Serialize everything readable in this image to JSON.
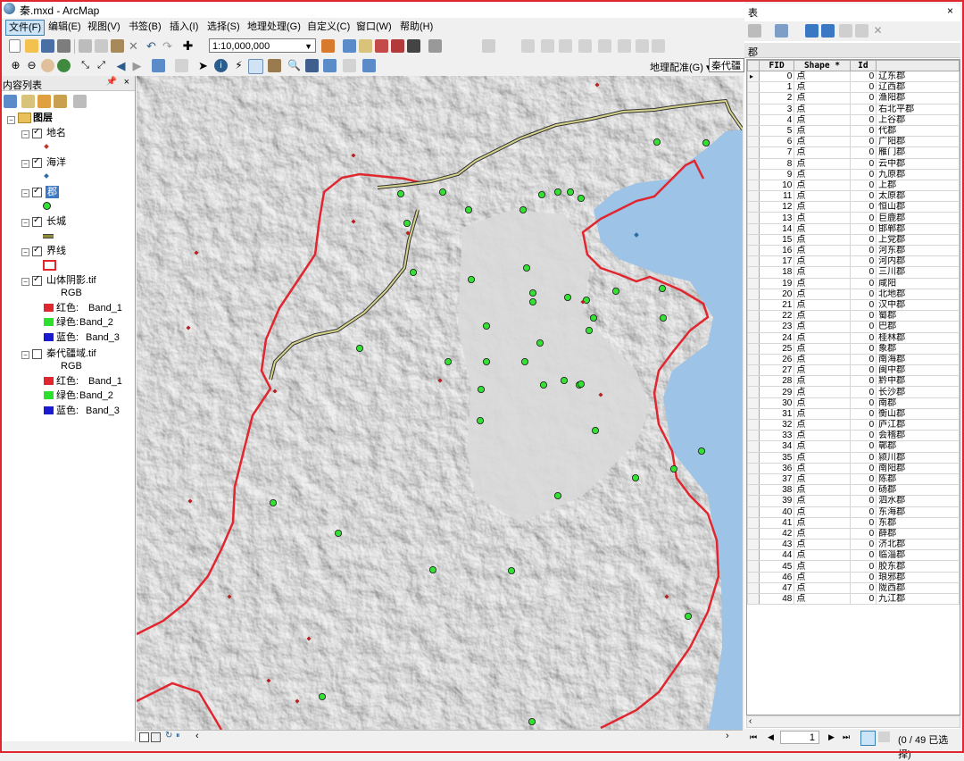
{
  "window": {
    "title": "秦.mxd - ArcMap"
  },
  "menubar": [
    "文件(F)",
    "编辑(E)",
    "视图(V)",
    "书签(B)",
    "插入(I)",
    "选择(S)",
    "地理处理(G)",
    "自定义(C)",
    "窗口(W)",
    "帮助(H)"
  ],
  "toolbar": {
    "scale_value": "1:10,000,000",
    "georef_label": "地理配准(G) ▾",
    "georef_layer": "秦代疆"
  },
  "toc": {
    "title": "内容列表",
    "pin": "ᵖ",
    "close": "×",
    "root": "图层",
    "layers": [
      {
        "name": "地名",
        "checked": true,
        "symbol": "diamond",
        "color": "#c0392b"
      },
      {
        "name": "海洋",
        "checked": true,
        "symbol": "diamond",
        "color": "#2e6da4"
      },
      {
        "name": "郡",
        "checked": true,
        "symbol": "circle",
        "color": "#33e033",
        "selected": true
      },
      {
        "name": "长城",
        "checked": true,
        "symbol": "line",
        "color": "#8c8c3c"
      },
      {
        "name": "界线",
        "checked": true,
        "symbol": "box",
        "color": "#e0262f"
      },
      {
        "name": "山体阴影.tif",
        "checked": true,
        "symbol": "raster"
      },
      {
        "name": "秦代疆域.tif",
        "checked": false,
        "symbol": "raster"
      }
    ],
    "raster_rgb": "RGB",
    "bands": [
      {
        "channel": "红色:",
        "band": "Band_1",
        "color": "#e0262f"
      },
      {
        "channel": "绿色:",
        "band": "Band_2",
        "color": "#2ee02e"
      },
      {
        "channel": "蓝色:",
        "band": "Band_3",
        "color": "#1a1ad0"
      }
    ]
  },
  "table_panel": {
    "title": "表",
    "close": "×",
    "tab": "郡",
    "columns": [
      "FID",
      "Shape *",
      "Id"
    ],
    "rows": [
      [
        0,
        "点",
        0,
        "辽东郡"
      ],
      [
        1,
        "点",
        0,
        "辽西郡"
      ],
      [
        2,
        "点",
        0,
        "渔阳郡"
      ],
      [
        3,
        "点",
        0,
        "右北平郡"
      ],
      [
        4,
        "点",
        0,
        "上谷郡"
      ],
      [
        5,
        "点",
        0,
        "代郡"
      ],
      [
        6,
        "点",
        0,
        "广阳郡"
      ],
      [
        7,
        "点",
        0,
        "雁门郡"
      ],
      [
        8,
        "点",
        0,
        "云中郡"
      ],
      [
        9,
        "点",
        0,
        "九原郡"
      ],
      [
        10,
        "点",
        0,
        "上郡"
      ],
      [
        11,
        "点",
        0,
        "太原郡"
      ],
      [
        12,
        "点",
        0,
        "恒山郡"
      ],
      [
        13,
        "点",
        0,
        "巨鹿郡"
      ],
      [
        14,
        "点",
        0,
        "邯郸郡"
      ],
      [
        15,
        "点",
        0,
        "上党郡"
      ],
      [
        16,
        "点",
        0,
        "河东郡"
      ],
      [
        17,
        "点",
        0,
        "河内郡"
      ],
      [
        18,
        "点",
        0,
        "三川郡"
      ],
      [
        19,
        "点",
        0,
        "咸阳"
      ],
      [
        20,
        "点",
        0,
        "北地郡"
      ],
      [
        21,
        "点",
        0,
        "汉中郡"
      ],
      [
        22,
        "点",
        0,
        "蜀郡"
      ],
      [
        23,
        "点",
        0,
        "巴郡"
      ],
      [
        24,
        "点",
        0,
        "桂林郡"
      ],
      [
        25,
        "点",
        0,
        "象郡"
      ],
      [
        26,
        "点",
        0,
        "南海郡"
      ],
      [
        27,
        "点",
        0,
        "闽中郡"
      ],
      [
        28,
        "点",
        0,
        "黔中郡"
      ],
      [
        29,
        "点",
        0,
        "长沙郡"
      ],
      [
        30,
        "点",
        0,
        "南郡"
      ],
      [
        31,
        "点",
        0,
        "衡山郡"
      ],
      [
        32,
        "点",
        0,
        "庐江郡"
      ],
      [
        33,
        "点",
        0,
        "会稽郡"
      ],
      [
        34,
        "点",
        0,
        "鄣郡"
      ],
      [
        35,
        "点",
        0,
        "颍川郡"
      ],
      [
        36,
        "点",
        0,
        "南阳郡"
      ],
      [
        37,
        "点",
        0,
        "陈郡"
      ],
      [
        38,
        "点",
        0,
        "砀郡"
      ],
      [
        39,
        "点",
        0,
        "泗水郡"
      ],
      [
        40,
        "点",
        0,
        "东海郡"
      ],
      [
        41,
        "点",
        0,
        "东郡"
      ],
      [
        42,
        "点",
        0,
        "薛郡"
      ],
      [
        43,
        "点",
        0,
        "济北郡"
      ],
      [
        44,
        "点",
        0,
        "临淄郡"
      ],
      [
        45,
        "点",
        0,
        "胶东郡"
      ],
      [
        46,
        "点",
        0,
        "琅邪郡"
      ],
      [
        47,
        "点",
        0,
        "陇西郡"
      ],
      [
        48,
        "点",
        0,
        "九江郡"
      ]
    ],
    "record_current": "1",
    "selection_status": "(0 / 49 已选择)"
  },
  "colors": {
    "border_line": "#e0262f",
    "commandery": "#33e033",
    "place": "#b52121",
    "sea": "#9dc3e6",
    "great_wall": "#8c8c3c"
  }
}
